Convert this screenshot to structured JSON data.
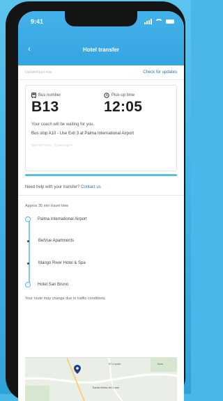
{
  "status_bar": {
    "time": "9:41"
  },
  "header": {
    "back_glyph": "‹",
    "title": "Hotel transfer"
  },
  "updates": {
    "last_updated": "Updated just now",
    "check_link": "Check for updates"
  },
  "pickup_card": {
    "bus_label": "Bus number",
    "bus_value": "B13",
    "time_label": "Pick-up time",
    "time_value": "12:05",
    "waiting_text": "Your coach will be waiting for you.",
    "stop_text": "Bus stop A10 - Use Exit 3 at Palma International Airport",
    "faint_text": "Wait 400 mins · 3 passengers"
  },
  "help": {
    "text": "Need help with your transfer?",
    "link": "Contact us"
  },
  "route": {
    "approx_text": "Approx 35 min travel time",
    "stops": [
      "Palma International Airport",
      "BelVue Apartments",
      "Mango River Hotel & Spa",
      "Hotel San Bruno"
    ]
  },
  "traffic_note": "Your route may change due to traffic conditions.",
  "map": {
    "label_1": "El Coyote",
    "label_2": "Santa Maria del Camí",
    "label_3": "Inca"
  },
  "colors": {
    "accent": "#3aa9e2",
    "link": "#2c6fb3",
    "background": "#49b8e8"
  },
  "icons": {
    "bus": "bus-icon",
    "clock": "clock-icon",
    "back": "back-arrow-icon",
    "pin": "map-pin-icon"
  }
}
